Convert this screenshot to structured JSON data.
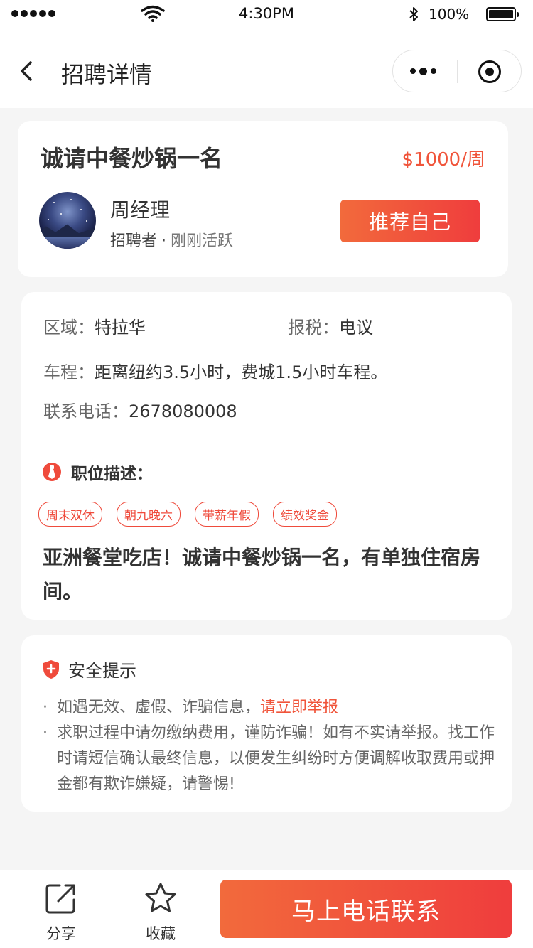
{
  "status_bar": {
    "time": "4:30PM",
    "battery": "100%"
  },
  "nav": {
    "title": "招聘详情",
    "icons": [
      "back-icon",
      "more-icon",
      "target-icon"
    ]
  },
  "job": {
    "title": "诚请中餐炒锅一名",
    "salary": "$1000/周",
    "recruiter_name": "周经理",
    "recruiter_role": "招聘者",
    "recruiter_dot": "·",
    "recruiter_status": "刚刚活跃",
    "recommend_label": "推荐自己"
  },
  "info": {
    "area_label": "区域：",
    "area_value": "特拉华",
    "tax_label": "报税：",
    "tax_value": "电议",
    "travel_label": "车程：",
    "travel_value": "距离纽约3.5小时，费城1.5小时车程。",
    "phone_label": "联系电话：",
    "phone_value": "2678080008"
  },
  "description": {
    "heading": "职位描述：",
    "tags": [
      "周末双休",
      "朝九晚六",
      "带薪年假",
      "绩效奖金"
    ],
    "text": "亚洲餐堂吃店！诚请中餐炒锅一名，有单独住宿房间。"
  },
  "safety": {
    "heading": "安全提示",
    "bullet": "·",
    "line1_text": "如遇无效、虚假、诈骗信息，",
    "line1_link": "请立即举报",
    "line2_text": "求职过程中请勿缴纳费用，谨防诈骗！如有不实请举报。找工作时请短信确认最终信息，以便发生纠纷时方便调解收取费用或押金都有欺诈嫌疑，请警惕!"
  },
  "bottom": {
    "share_label": "分享",
    "favorite_label": "收藏",
    "call_label": "马上电话联系"
  },
  "colors": {
    "accent": "#f0543a",
    "button_gradient_start": "#f26a3c",
    "button_gradient_end": "#ef3d3d",
    "background": "#f5f5f5"
  }
}
